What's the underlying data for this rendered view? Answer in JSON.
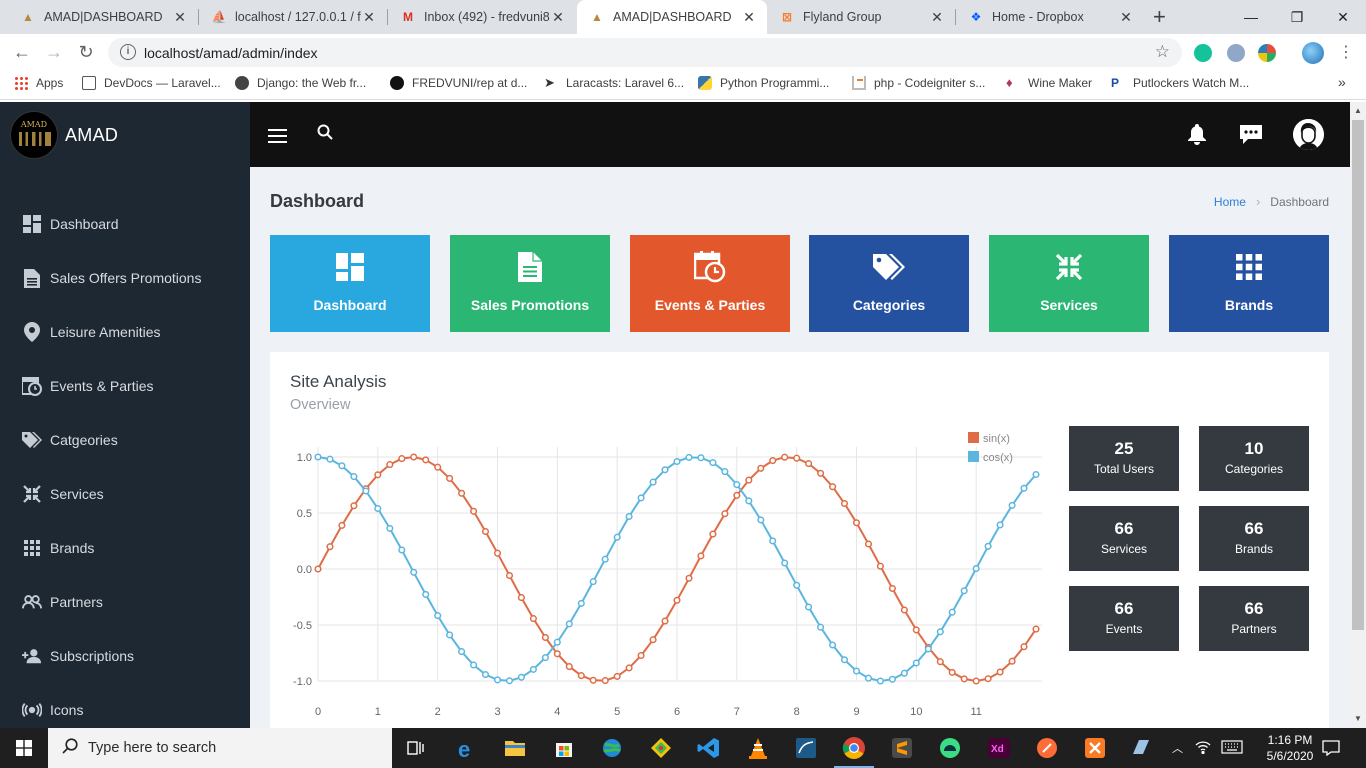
{
  "browser": {
    "tabs": [
      {
        "title": "AMAD|DASHBOARD",
        "active": false
      },
      {
        "title": "localhost / 127.0.0.1 / fl",
        "active": false
      },
      {
        "title": "Inbox (492) - fredvuni8",
        "active": false
      },
      {
        "title": "AMAD|DASHBOARD",
        "active": true
      },
      {
        "title": "Flyland Group",
        "active": false
      },
      {
        "title": "Home - Dropbox",
        "active": false
      }
    ],
    "url": "localhost/amad/admin/index",
    "bookmarks": [
      "Apps",
      "DevDocs — Laravel...",
      "Django: the Web fr...",
      "FREDVUNI/rep at d...",
      "Laracasts: Laravel 6...",
      "Python Programmi...",
      "php - Codeigniter s...",
      "Wine Maker",
      "Putlockers Watch M..."
    ],
    "more": "»"
  },
  "sidebar": {
    "brand": "AMAD",
    "logo_text": "AMAD",
    "items": [
      {
        "label": "Dashboard",
        "icon": "dashboard-icon"
      },
      {
        "label": "Sales Offers Promotions",
        "icon": "file-icon"
      },
      {
        "label": "Leisure Amenities",
        "icon": "map-pin-icon"
      },
      {
        "label": "Events & Parties",
        "icon": "calendar-icon"
      },
      {
        "label": "Catgeories",
        "icon": "tags-icon"
      },
      {
        "label": "Services",
        "icon": "compress-icon"
      },
      {
        "label": "Brands",
        "icon": "grid-icon"
      },
      {
        "label": "Partners",
        "icon": "users-icon"
      },
      {
        "label": "Subscriptions",
        "icon": "user-plus-icon"
      },
      {
        "label": "Icons",
        "icon": "broadcast-icon"
      }
    ]
  },
  "page": {
    "title": "Dashboard",
    "breadcrumb": {
      "home": "Home",
      "current": "Dashboard"
    }
  },
  "tiles": [
    {
      "label": "Dashboard",
      "color": "#29a8e0",
      "icon": "dashboard-icon"
    },
    {
      "label": "Sales Promotions",
      "color": "#2bb673",
      "icon": "file-icon"
    },
    {
      "label": "Events & Parties",
      "color": "#e2572b",
      "icon": "calendar-icon"
    },
    {
      "label": "Categories",
      "color": "#2452a1",
      "icon": "tags-icon"
    },
    {
      "label": "Services",
      "color": "#2bb673",
      "icon": "compress-icon"
    },
    {
      "label": "Brands",
      "color": "#2452a1",
      "icon": "grid-icon"
    }
  ],
  "analysis": {
    "title": "Site Analysis",
    "subtitle": "Overview",
    "stats": [
      {
        "value": "25",
        "label": "Total Users"
      },
      {
        "value": "10",
        "label": "Categories"
      },
      {
        "value": "66",
        "label": "Services"
      },
      {
        "value": "66",
        "label": "Brands"
      },
      {
        "value": "66",
        "label": "Events"
      },
      {
        "value": "66",
        "label": "Partners"
      }
    ]
  },
  "chart_data": {
    "type": "line",
    "title": "",
    "xlabel": "",
    "ylabel": "",
    "xlim": [
      0,
      12.1
    ],
    "ylim": [
      -1.0,
      1.0
    ],
    "xticks": [
      0,
      1,
      2,
      3,
      4,
      5,
      6,
      7,
      8,
      9,
      10,
      11
    ],
    "yticks": [
      "1.0",
      "0.5",
      "0.0",
      "-0.5",
      "-1.0"
    ],
    "x_step": 0.2,
    "grid": true,
    "legend_position": "top-right",
    "series": [
      {
        "name": "sin(x)",
        "color": "#e06c45"
      },
      {
        "name": "cos(x)",
        "color": "#5bb6df"
      }
    ]
  },
  "taskbar": {
    "search_placeholder": "Type here to search",
    "time": "1:16 PM",
    "date": "5/6/2020"
  }
}
